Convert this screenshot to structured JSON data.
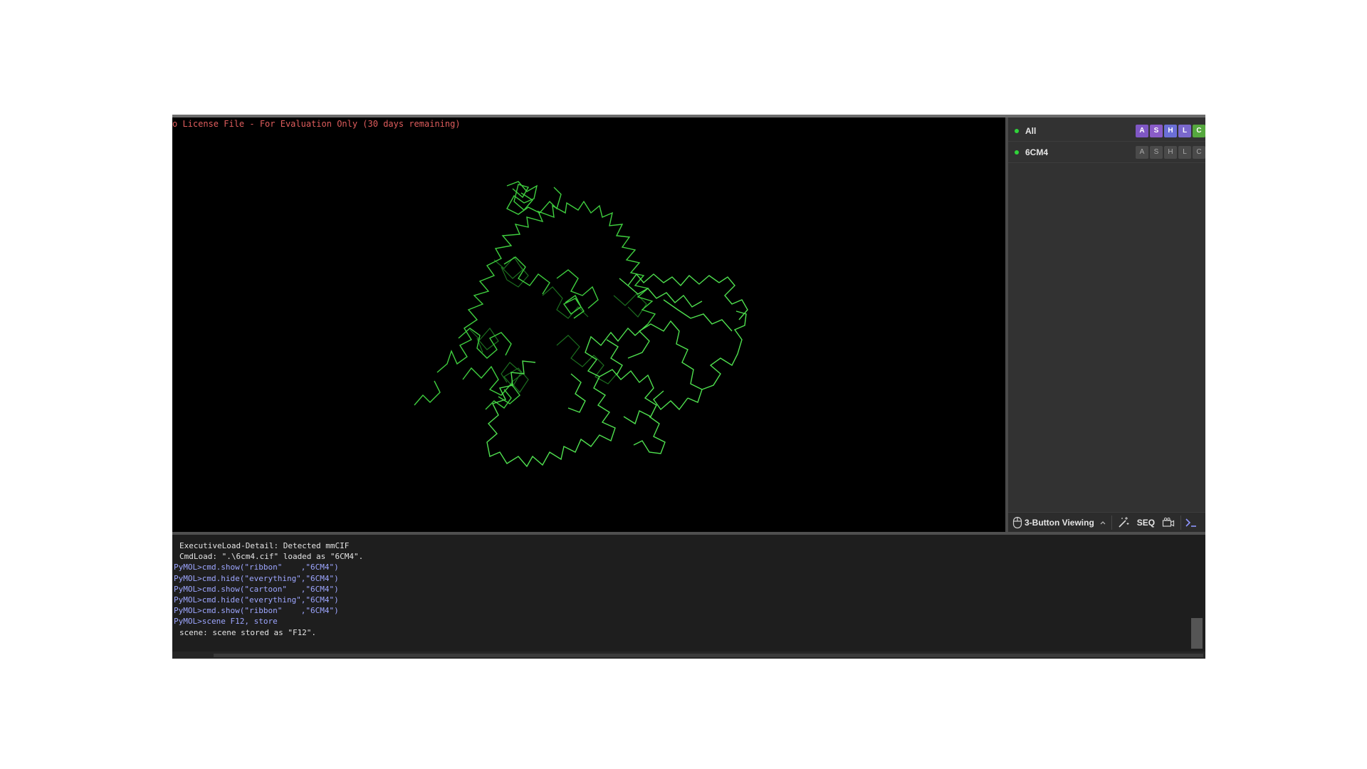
{
  "viewer": {
    "license_text": "o License File - For Evaluation Only (30 days remaining)"
  },
  "object_panel": {
    "rows": [
      {
        "name": "All",
        "buttons": [
          "A",
          "S",
          "H",
          "L",
          "C"
        ]
      },
      {
        "name": "6CM4",
        "buttons": [
          "A",
          "S",
          "H",
          "L",
          "C"
        ]
      }
    ]
  },
  "toolbar": {
    "mouse_mode_label": "3-Button Viewing",
    "seq_label": "SEQ"
  },
  "console": {
    "lines": [
      "ExecutiveLoad-Detail: Detected mmCIF",
      "CmdLoad: \".\\6cm4.cif\" loaded as \"6CM4\".",
      "PyMOL>cmd.show(\"ribbon\"    ,\"6CM4\")",
      "PyMOL>cmd.hide(\"everything\",\"6CM4\")",
      "PyMOL>cmd.show(\"cartoon\"   ,\"6CM4\")",
      "PyMOL>cmd.hide(\"everything\",\"6CM4\")",
      "PyMOL>cmd.show(\"ribbon\"    ,\"6CM4\")",
      "PyMOL>scene F12, store",
      "scene: scene stored as \"F12\"."
    ]
  },
  "colors": {
    "button_A": "#7f57c4",
    "button_S": "#8a5cc8",
    "button_H": "#6b6fd6",
    "button_L": "#7a68cc",
    "button_C": "#56a83f",
    "ribbon_green": "#3fcf3f",
    "object_enabled_dot": "#2fd43a",
    "license_text": "#e05d5d",
    "command_text": "#9da6ff"
  }
}
